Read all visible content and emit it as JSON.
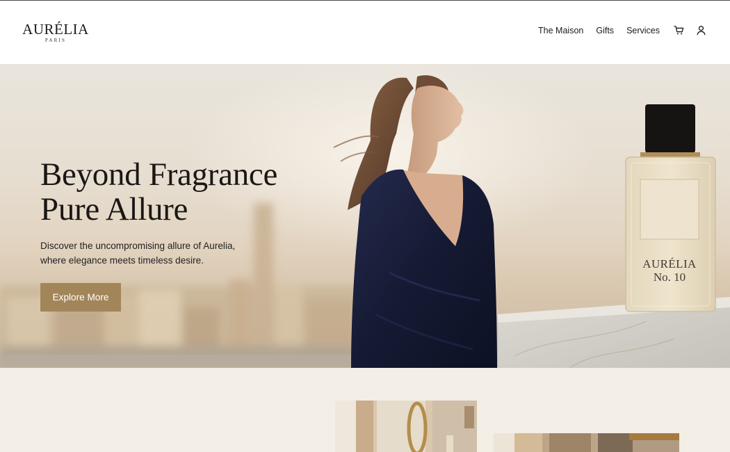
{
  "brand": {
    "name": "AURÉLIA",
    "tagline": "PARIS"
  },
  "nav": {
    "links": [
      "The Maison",
      "Gifts",
      "Services"
    ],
    "icons": [
      "cart-icon",
      "account-icon"
    ]
  },
  "hero": {
    "title_line1": "Beyond Fragrance",
    "title_line2": "Pure Allure",
    "desc_line1": "Discover the uncompromising allure of Aurelia,",
    "desc_line2": "where elegance meets timeless desire.",
    "cta_label": "Explore More",
    "bottle_label": {
      "brand": "AURÉLIA",
      "number": "No. 10"
    }
  },
  "colors": {
    "accent": "#a3855a",
    "page_background": "#f3eee6",
    "header_background": "#ffffff",
    "text": "#1a1714",
    "dress": "#1d2240"
  }
}
